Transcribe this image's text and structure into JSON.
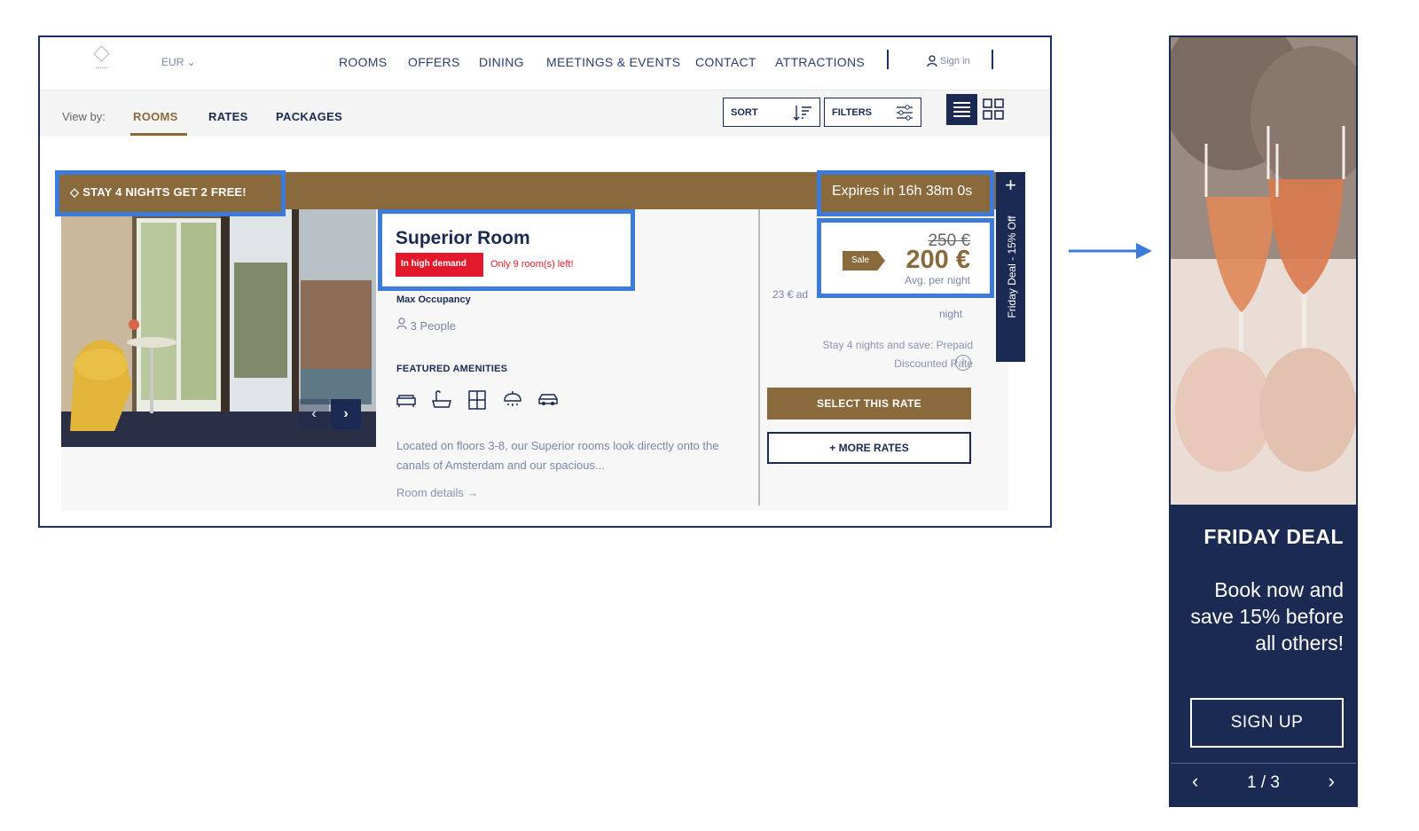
{
  "header": {
    "currency": "EUR",
    "nav": [
      "ROOMS",
      "OFFERS",
      "DINING",
      "MEETINGS & EVENTS",
      "CONTACT",
      "ATTRACTIONS"
    ],
    "sign_in": "Sign in"
  },
  "viewbar": {
    "label": "View by:",
    "tabs": [
      "ROOMS",
      "RATES",
      "PACKAGES"
    ],
    "active_tab": "ROOMS",
    "sort": "SORT",
    "filters": "FILTERS"
  },
  "promo": {
    "badge": "STAY 4 NIGHTS GET 2 FREE!",
    "expires": "Expires in 16h 38m 0s"
  },
  "room": {
    "title": "Superior Room",
    "demand": "In high demand",
    "rooms_left": "Only 9 room(s) left!",
    "occupancy_label": "Max Occupancy",
    "occupancy_value": "3 People",
    "amenities_label": "FEATURED AMENITIES",
    "amenity_icons": [
      "sofa-icon",
      "bathtub-icon",
      "window-view-icon",
      "shower-icon",
      "car-icon"
    ],
    "description": "Located on floors 3-8, our Superior rooms look directly onto the canals of Amsterdam and our spacious...",
    "details_link": "Room details →"
  },
  "pricing": {
    "old_price": "250 €",
    "sale_tag": "Sale",
    "new_price": "200 €",
    "avg_label": "Avg. per night",
    "extra_line1": "23 € ad",
    "extra_line2": "night",
    "stay_save": "Stay 4 nights and save: Prepaid Discounted Rate",
    "info": "i",
    "select_rate": "SELECT THIS RATE",
    "more_rates": "+ MORE RATES"
  },
  "friday_tab": {
    "plus": "+",
    "label": "Friday Deal - 15% Off"
  },
  "side_panel": {
    "title": "FRIDAY DEAL",
    "text": "Book now and save 15% before all others!",
    "signup": "SIGN UP",
    "prev": "‹",
    "counter": "1 / 3",
    "next": "›"
  },
  "colors": {
    "navy": "#1b2a52",
    "gold": "#8a6a3d",
    "highlight": "#3c7bd9",
    "alert": "#e3192b"
  }
}
